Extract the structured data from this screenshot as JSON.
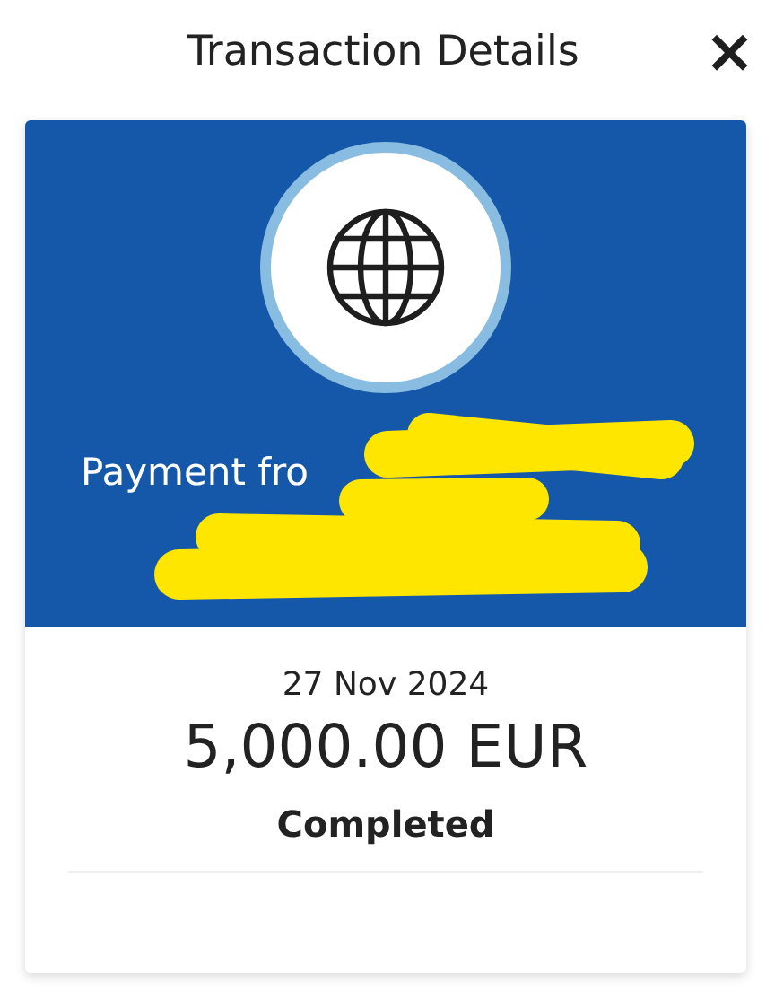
{
  "header": {
    "title": "Transaction Details",
    "close": "×"
  },
  "transaction": {
    "description": "Payment fro",
    "date": "27 Nov 2024",
    "amount": "5,000.00 EUR",
    "status": "Completed"
  }
}
